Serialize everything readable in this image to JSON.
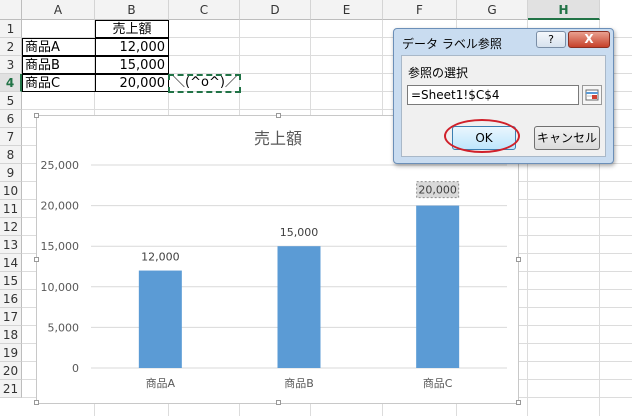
{
  "sheet": {
    "columns": [
      "A",
      "B",
      "C",
      "D",
      "E",
      "F",
      "G",
      "H"
    ],
    "active_column": "H",
    "rows": [
      "1",
      "2",
      "3",
      "4",
      "5",
      "6",
      "7",
      "8",
      "9",
      "10",
      "11",
      "12",
      "13",
      "14",
      "15",
      "16",
      "17",
      "18",
      "19",
      "20",
      "21"
    ],
    "active_row": "4",
    "header_b1": "売上額",
    "data_rows": [
      {
        "label": "商品A",
        "value": "12,000"
      },
      {
        "label": "商品B",
        "value": "15,000"
      },
      {
        "label": "商品C",
        "value": "20,000"
      }
    ],
    "c4_text": "＼(^o^)／"
  },
  "chart_data": {
    "type": "bar",
    "title": "売上額",
    "categories": [
      "商品A",
      "商品B",
      "商品C"
    ],
    "values": [
      12000,
      15000,
      20000
    ],
    "data_labels": [
      "12,000",
      "15,000",
      "20,000"
    ],
    "ylim": [
      0,
      25000
    ],
    "yticks": [
      "0",
      "5,000",
      "10,000",
      "15,000",
      "20,000",
      "25,000"
    ],
    "grid": true,
    "bar_color": "#5b9bd5"
  },
  "dialog": {
    "title": "データ ラベル参照",
    "help_label": "?",
    "close_label": "X",
    "section_label": "参照の選択",
    "reference_value": "=Sheet1!$C$4",
    "ok_label": "OK",
    "cancel_label": "キャンセル"
  }
}
